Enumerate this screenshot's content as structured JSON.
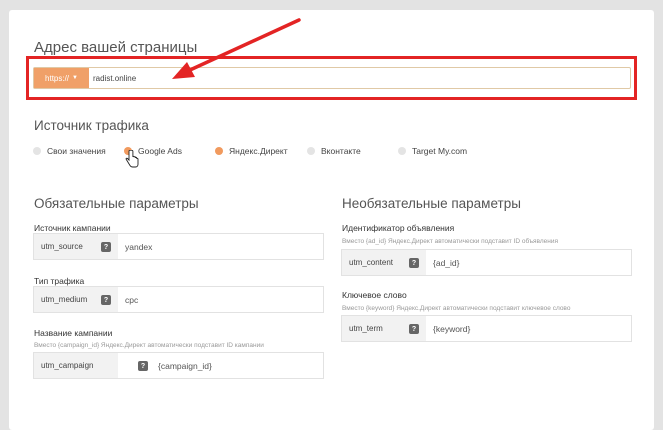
{
  "page": {
    "address_title": "Адрес вашей страницы",
    "protocol_label": "https://",
    "url_value": "radist.online"
  },
  "traffic": {
    "title": "Источник трафика",
    "options": [
      {
        "label": "Свои значения",
        "selected": false
      },
      {
        "label": "Google Ads",
        "selected": true
      },
      {
        "label": "Яндекс.Директ",
        "selected": true
      },
      {
        "label": "Вконтакте",
        "selected": false
      },
      {
        "label": "Target My.com",
        "selected": false
      }
    ]
  },
  "required": {
    "title": "Обязательные параметры",
    "fields": [
      {
        "label": "Источник кампании",
        "hint": "",
        "param": "utm_source",
        "value": "yandex"
      },
      {
        "label": "Тип трафика",
        "hint": "",
        "param": "utm_medium",
        "value": "cpc"
      },
      {
        "label": "Название кампании",
        "hint": "Вместо {campaign_id} Яндекс.Директ автоматически подставит ID кампании",
        "param": "utm_campaign",
        "value": "{campaign_id}"
      }
    ]
  },
  "optional": {
    "title": "Необязательные параметры",
    "fields": [
      {
        "label": "Идентификатор объявления",
        "hint": "Вместо {ad_id} Яндекс.Директ автоматически подставит ID объявления",
        "param": "utm_content",
        "value": "{ad_id}"
      },
      {
        "label": "Ключевое слово",
        "hint": "Вместо {keyword} Яндекс.Директ автоматически подставит ключевое слово",
        "param": "utm_term",
        "value": "{keyword}"
      }
    ]
  },
  "help_glyph": "?",
  "colors": {
    "accent": "#f19a5e",
    "annotation": "#e32424"
  }
}
